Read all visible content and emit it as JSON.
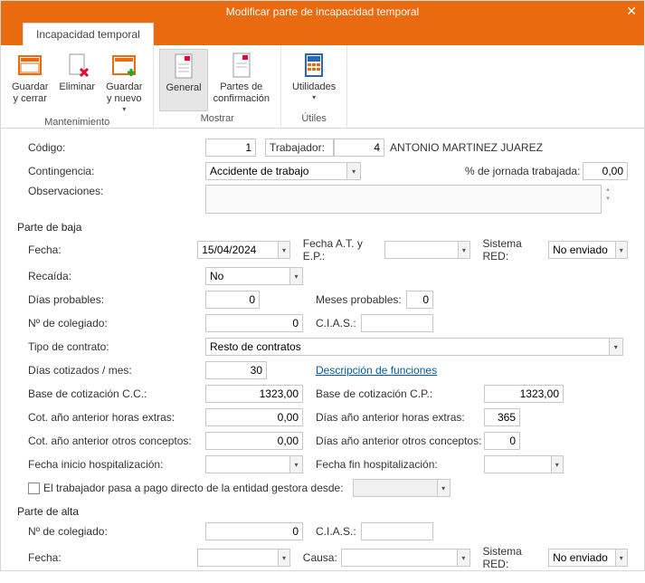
{
  "window": {
    "title": "Modificar parte de incapacidad temporal",
    "tab": "Incapacidad temporal"
  },
  "ribbon": {
    "mantenimiento": {
      "caption": "Mantenimiento",
      "guardar_cerrar": "Guardar\ny cerrar",
      "eliminar": "Eliminar",
      "guardar_nuevo": "Guardar\ny nuevo"
    },
    "mostrar": {
      "caption": "Mostrar",
      "general": "General",
      "partes_conf": "Partes de\nconfirmación"
    },
    "utiles": {
      "caption": "Útiles",
      "utilidades": "Utilidades"
    }
  },
  "form": {
    "codigo_label": "Código:",
    "codigo_val": "1",
    "trabajador_label": "Trabajador:",
    "trabajador_num": "4",
    "trabajador_nombre": "ANTONIO MARTINEZ JUAREZ",
    "contingencia_label": "Contingencia:",
    "contingencia_val": "Accidente de trabajo",
    "pct_jornada_label": "% de jornada trabajada:",
    "pct_jornada_val": "0,00",
    "observaciones_label": "Observaciones:",
    "observaciones_val": ""
  },
  "baja": {
    "title": "Parte de baja",
    "fecha_label": "Fecha:",
    "fecha_val": "15/04/2024",
    "fecha_at_label": "Fecha A.T. y E.P.:",
    "fecha_at_val": "",
    "sistema_red_label": "Sistema RED:",
    "sistema_red_val": "No enviado",
    "recaida_label": "Recaída:",
    "recaida_val": "No",
    "dias_prob_label": "Días probables:",
    "dias_prob_val": "0",
    "meses_prob_label": "Meses probables:",
    "meses_prob_val": "0",
    "colegiado_label": "Nº de colegiado:",
    "colegiado_val": "0",
    "cias_label": "C.I.A.S.:",
    "cias_val": "",
    "tipo_contrato_label": "Tipo de contrato:",
    "tipo_contrato_val": "Resto de contratos",
    "dias_cotizados_label": "Días cotizados / mes:",
    "dias_cotizados_val": "30",
    "descripcion_func": "Descripción de funciones",
    "base_cc_label": "Base de cotización C.C.:",
    "base_cc_val": "1323,00",
    "base_cp_label": "Base de cotización C.P.:",
    "base_cp_val": "1323,00",
    "cot_horas_label": "Cot. año anterior horas extras:",
    "cot_horas_val": "0,00",
    "dias_horas_label": "Días año anterior horas extras:",
    "dias_horas_val": "365",
    "cot_otros_label": "Cot. año anterior otros conceptos:",
    "cot_otros_val": "0,00",
    "dias_otros_label": "Días año anterior otros conceptos:",
    "dias_otros_val": "0",
    "fecha_ini_hosp_label": "Fecha inicio hospitalización:",
    "fecha_ini_hosp_val": "",
    "fecha_fin_hosp_label": "Fecha fin hospitalización:",
    "fecha_fin_hosp_val": "",
    "pago_directo_label": "El trabajador pasa a pago directo de la entidad gestora desde:",
    "pago_directo_val": ""
  },
  "alta": {
    "title": "Parte de alta",
    "colegiado_label": "Nº de colegiado:",
    "colegiado_val": "0",
    "cias_label": "C.I.A.S.:",
    "cias_val": "",
    "fecha_label": "Fecha:",
    "fecha_val": "",
    "causa_label": "Causa:",
    "causa_val": "",
    "sistema_red_label": "Sistema RED:",
    "sistema_red_val": "No enviado"
  }
}
